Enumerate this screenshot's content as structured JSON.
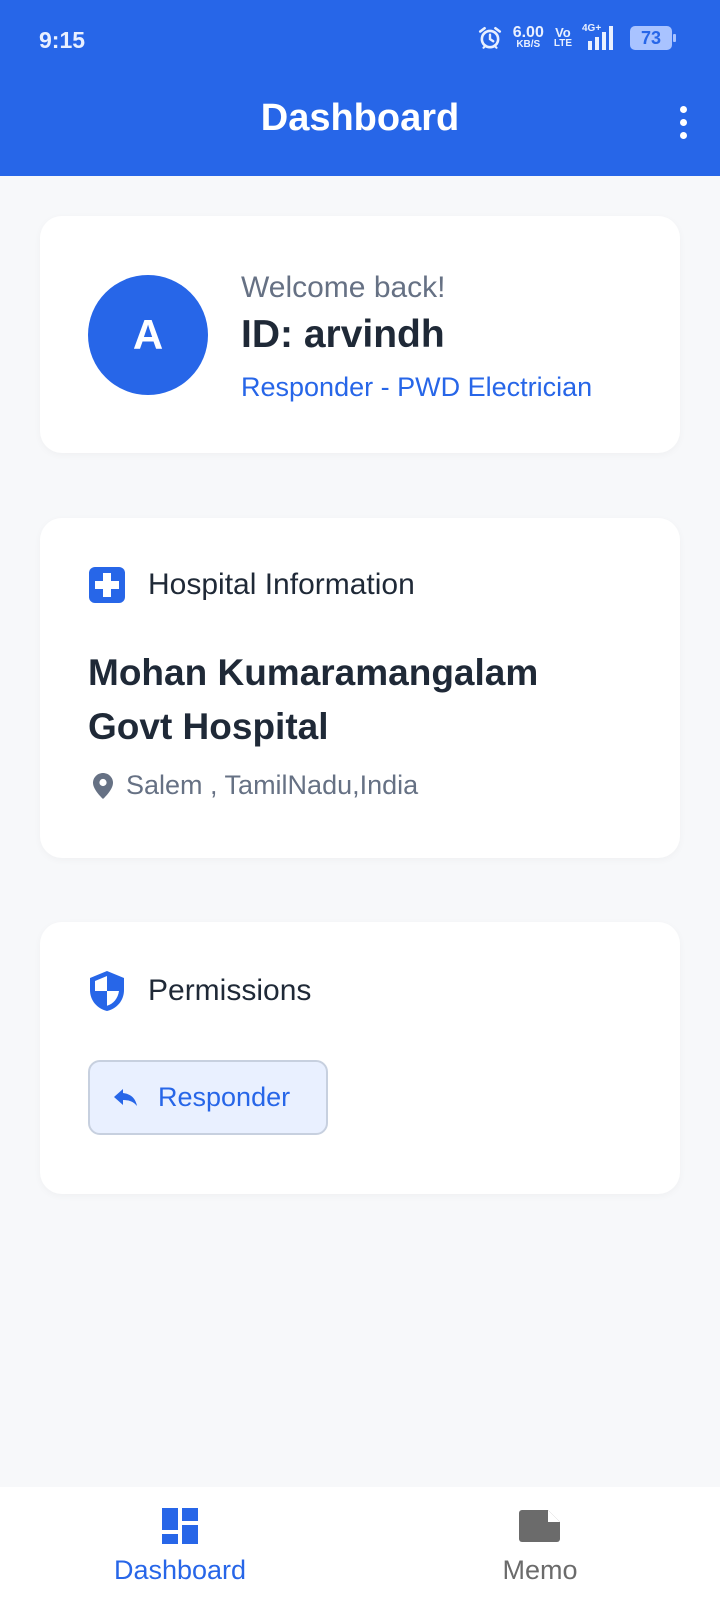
{
  "status_bar": {
    "time": "9:15",
    "speed_value": "6.00",
    "speed_unit": "KB/S",
    "volte_top": "Vo",
    "volte_bottom": "LTE",
    "network": "4G+",
    "battery": "73"
  },
  "app_bar": {
    "title": "Dashboard"
  },
  "profile": {
    "avatar_letter": "A",
    "welcome": "Welcome back!",
    "id": "ID: arvindh",
    "role": "Responder - PWD Electrician"
  },
  "hospital": {
    "section_title": "Hospital Information",
    "name": "Mohan Kumaramangalam Govt Hospital",
    "location": "Salem , TamilNadu,India"
  },
  "permissions": {
    "section_title": "Permissions",
    "chip_label": "Responder"
  },
  "bottom_nav": {
    "dashboard_label": "Dashboard",
    "memo_label": "Memo"
  },
  "colors": {
    "primary": "#2766e8",
    "background": "#f7f8fa",
    "text_dark": "#1f2937",
    "text_muted": "#667184"
  }
}
